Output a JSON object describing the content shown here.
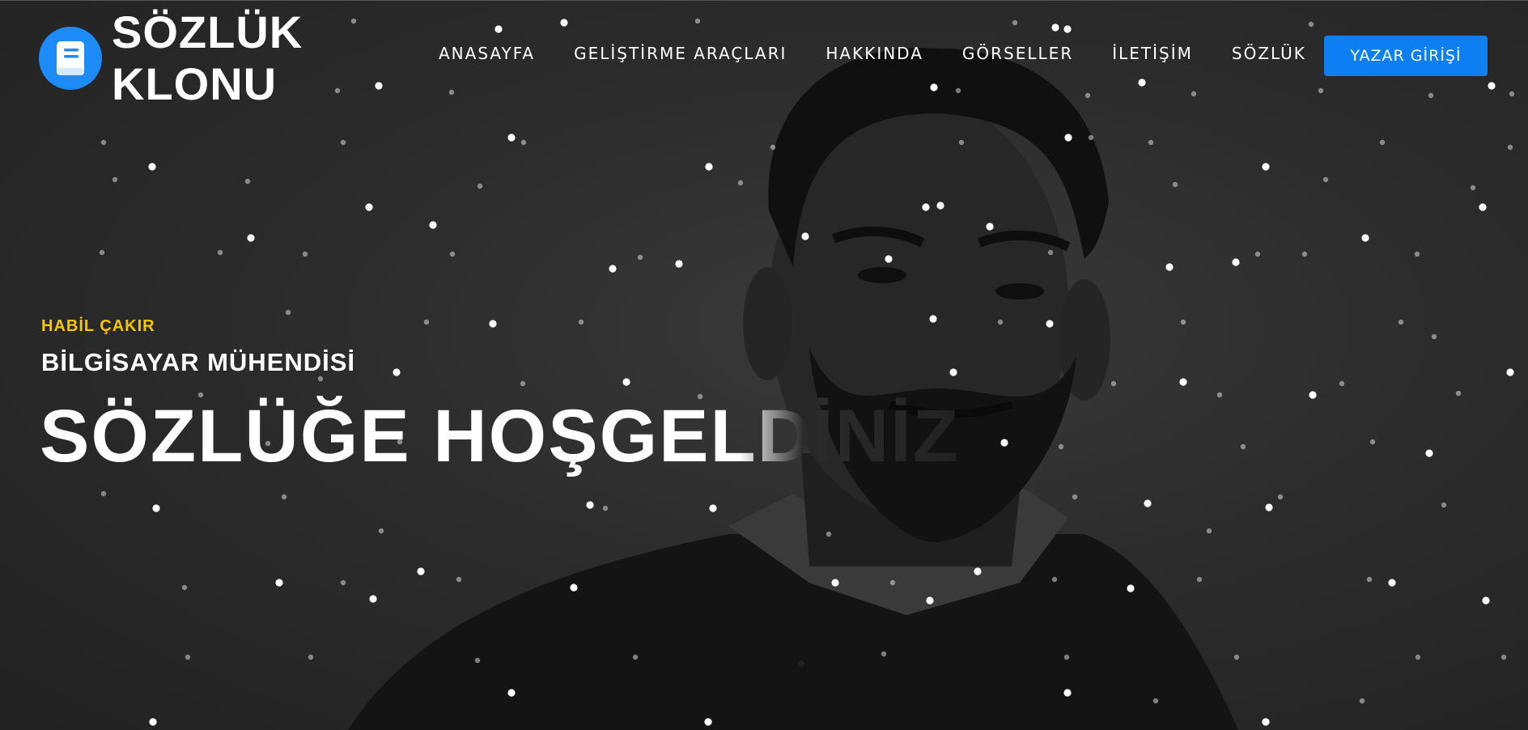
{
  "brand": {
    "name_line1": "SÖZLÜK",
    "name_line2": "KLONU",
    "logo_icon": "book-icon",
    "accent": "#1d8cf8"
  },
  "nav": {
    "items": [
      "ANASAYFA",
      "GELİŞTİRME ARAÇLARI",
      "HAKKINDA",
      "GÖRSELLER",
      "İLETİŞİM",
      "SÖZLÜK"
    ],
    "cta_label": "YAZAR GİRİŞİ",
    "cta_color": "#0d7ff2"
  },
  "hero": {
    "name": "HABİL ÇAKIR",
    "name_color": "#f7c600",
    "title": "BİLGİSAYAR MÜHENDİSİ",
    "headline": "SÖZLÜĞE HOŞGELDİNİZ"
  }
}
